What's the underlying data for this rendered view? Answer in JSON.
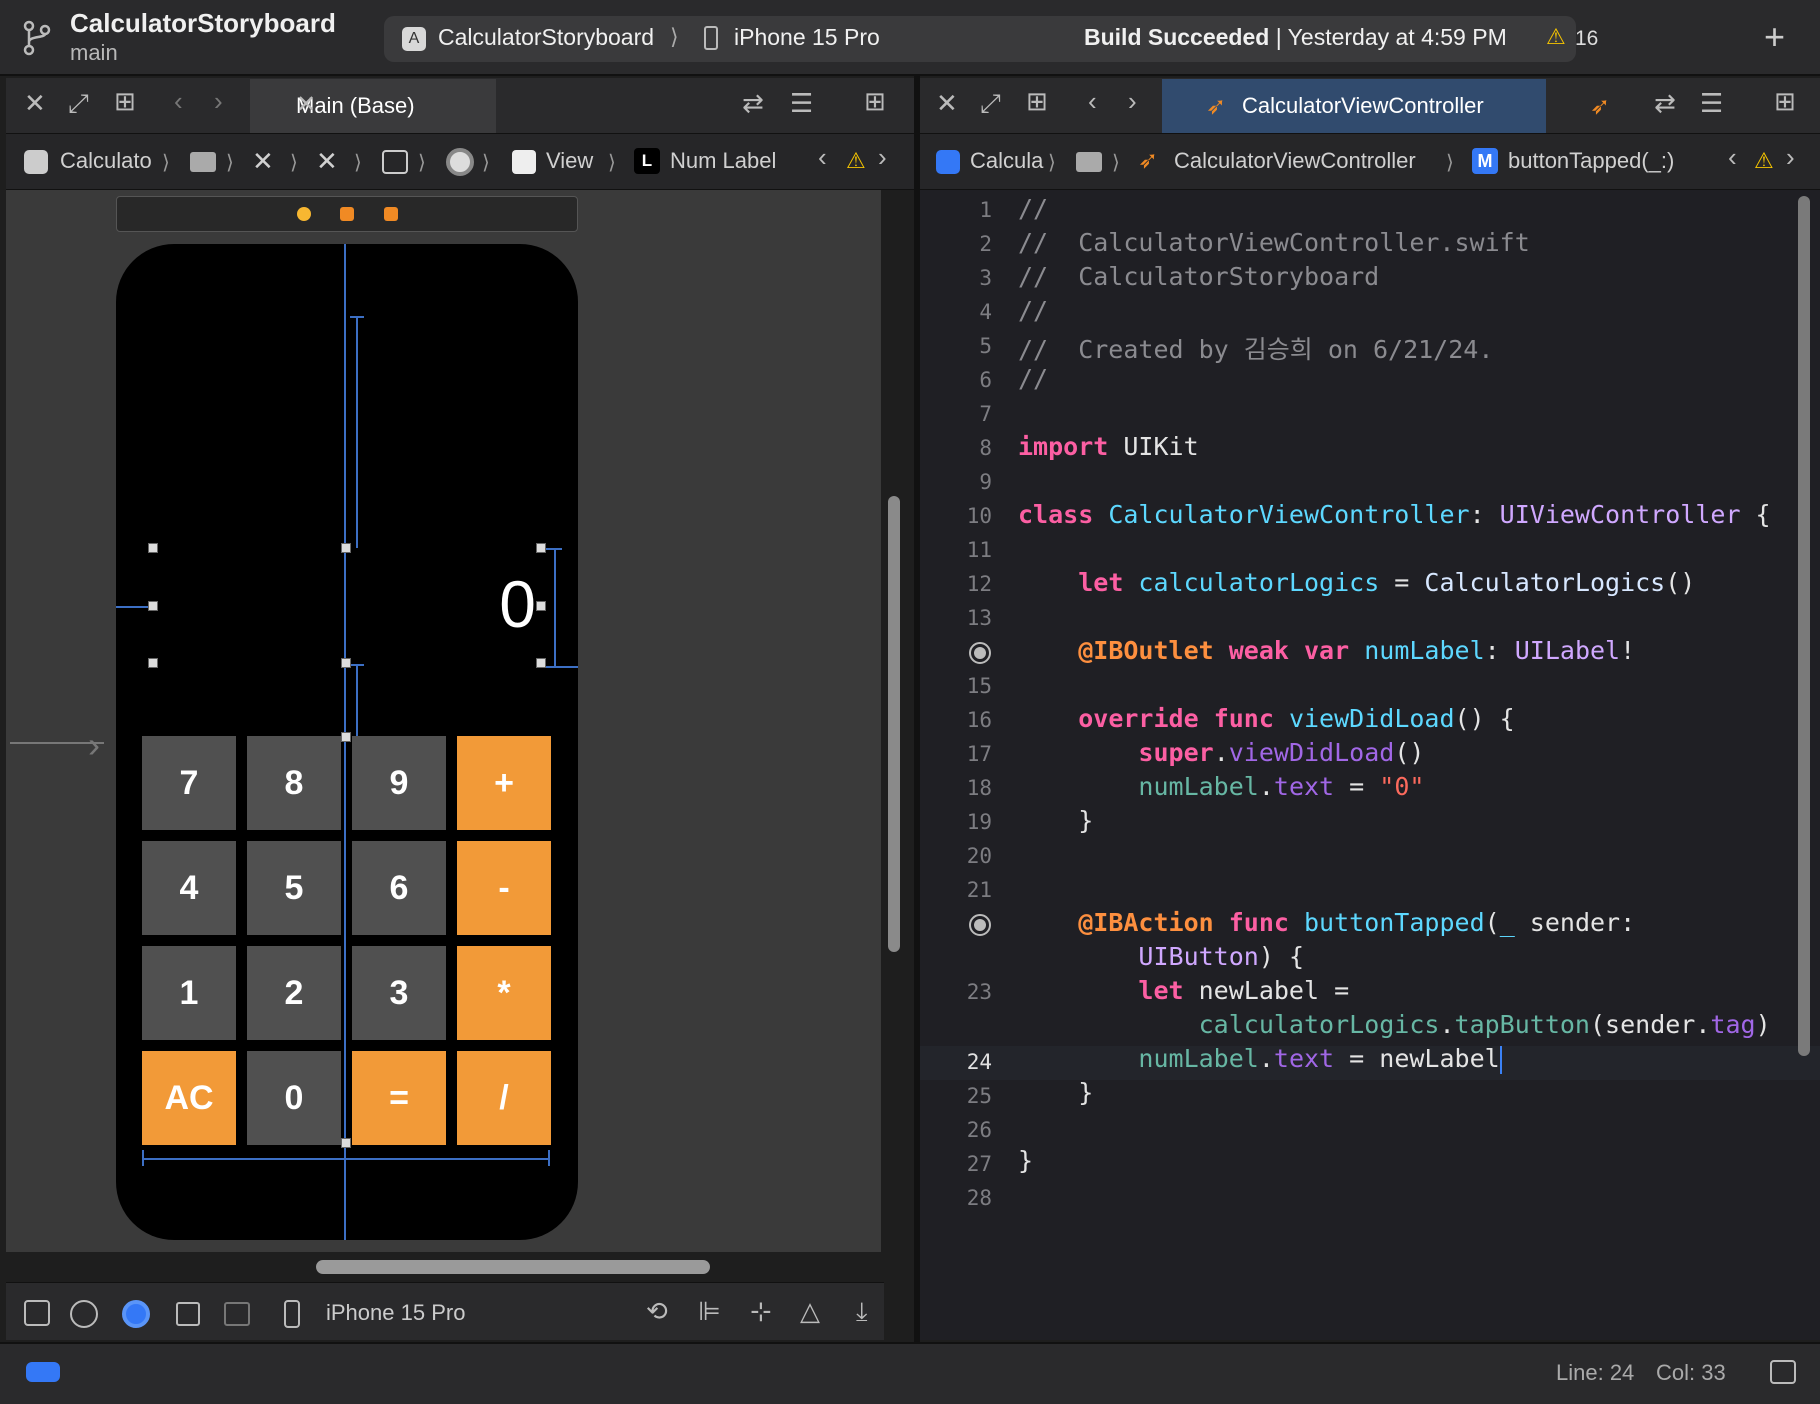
{
  "toolbar": {
    "project_title": "CalculatorStoryboard",
    "branch": "main",
    "scheme_name": "CalculatorStoryboard",
    "scheme_separator": "⟩",
    "device_name": "iPhone 15 Pro",
    "build_status_bold": "Build Succeeded",
    "build_status_rest": " | Yesterday at 4:59 PM",
    "warning_count": "16",
    "warning_color": "#f5c400"
  },
  "left_pane": {
    "tab_label": "Main (Base)",
    "jumpbar": {
      "items": [
        "Calculato",
        "View",
        "Num Label"
      ],
      "label_badge": "L"
    },
    "phone": {
      "display_value": "0",
      "buttons": [
        {
          "label": "7",
          "style": "gray"
        },
        {
          "label": "8",
          "style": "gray"
        },
        {
          "label": "9",
          "style": "gray"
        },
        {
          "label": "+",
          "style": "orange"
        },
        {
          "label": "4",
          "style": "gray"
        },
        {
          "label": "5",
          "style": "gray"
        },
        {
          "label": "6",
          "style": "gray"
        },
        {
          "label": "-",
          "style": "orange"
        },
        {
          "label": "1",
          "style": "gray"
        },
        {
          "label": "2",
          "style": "gray"
        },
        {
          "label": "3",
          "style": "gray"
        },
        {
          "label": "*",
          "style": "orange"
        },
        {
          "label": "AC",
          "style": "orange"
        },
        {
          "label": "0",
          "style": "gray"
        },
        {
          "label": "=",
          "style": "orange"
        },
        {
          "label": "/",
          "style": "orange"
        }
      ],
      "orange_color": "#f29a38",
      "gray_color": "#505050"
    },
    "bottom_bar": {
      "device_name": "iPhone 15 Pro"
    }
  },
  "right_pane": {
    "tab_label": "CalculatorViewController",
    "jumpbar": {
      "items": [
        "Calcula",
        "CalculatorViewController",
        "buttonTapped(_:)"
      ],
      "method_badge": "M"
    },
    "gutter": [
      "1",
      "2",
      "3",
      "4",
      "5",
      "6",
      "7",
      "8",
      "9",
      "10",
      "11",
      "12",
      "13",
      "",
      "15",
      "16",
      "17",
      "18",
      "19",
      "20",
      "21",
      "",
      "",
      "23",
      "24",
      "25",
      "26",
      "27",
      "28"
    ],
    "code": {
      "l1": "//",
      "l2": "//  CalculatorViewController.swift",
      "l3": "//  CalculatorStoryboard",
      "l4": "//",
      "l5": "//  Created by 김승희 on 6/21/24.",
      "l6": "//",
      "l8_kw": "import",
      "l8_rest": " UIKit",
      "l10_kw": "class",
      "l10_name": " CalculatorViewController",
      "l10_colon": ": ",
      "l10_super": "UIViewController",
      "l10_brace": " {",
      "l12_kw": "let",
      "l12_var": " calculatorLogics",
      "l12_eq": " = ",
      "l12_type": "CalculatorLogics",
      "l12_paren": "()",
      "l14_attr": "@IBOutlet",
      "l14_weak": " weak",
      "l14_var": " var",
      "l14_name": " numLabel",
      "l14_colon": ": ",
      "l14_type": "UILabel",
      "l14_bang": "!",
      "l16_override": "override",
      "l16_func": " func",
      "l16_name": " viewDidLoad",
      "l16_rest": "() {",
      "l17_super": "super",
      "l17_dot": ".",
      "l17_call": "viewDidLoad",
      "l17_rest": "()",
      "l18_obj": "numLabel",
      "l18_dot": ".",
      "l18_prop": "text",
      "l18_eq": " = ",
      "l18_str": "\"0\"",
      "l19": "}",
      "l22_attr": "@IBAction",
      "l22_func": " func",
      "l22_name": " buttonTapped",
      "l22_paren": "(",
      "l22_us": "_",
      "l22_rest": " sender:",
      "l22b_type": "UIButton",
      "l22b_rest": ") {",
      "l23_kw": "let",
      "l23_rest": " newLabel =",
      "l23b_obj": "calculatorLogics",
      "l23b_dot": ".",
      "l23b_call": "tapButton",
      "l23b_paren": "(sender.",
      "l23b_prop": "tag",
      "l23b_close": ")",
      "l24_obj": "numLabel",
      "l24_dot": ".",
      "l24_prop": "text",
      "l24_rest": " = newLabel",
      "l25": "}",
      "l27": "}"
    }
  },
  "status_bar": {
    "line": "Line: 24",
    "col": "Col: 33",
    "badge_color": "#3478f6"
  }
}
